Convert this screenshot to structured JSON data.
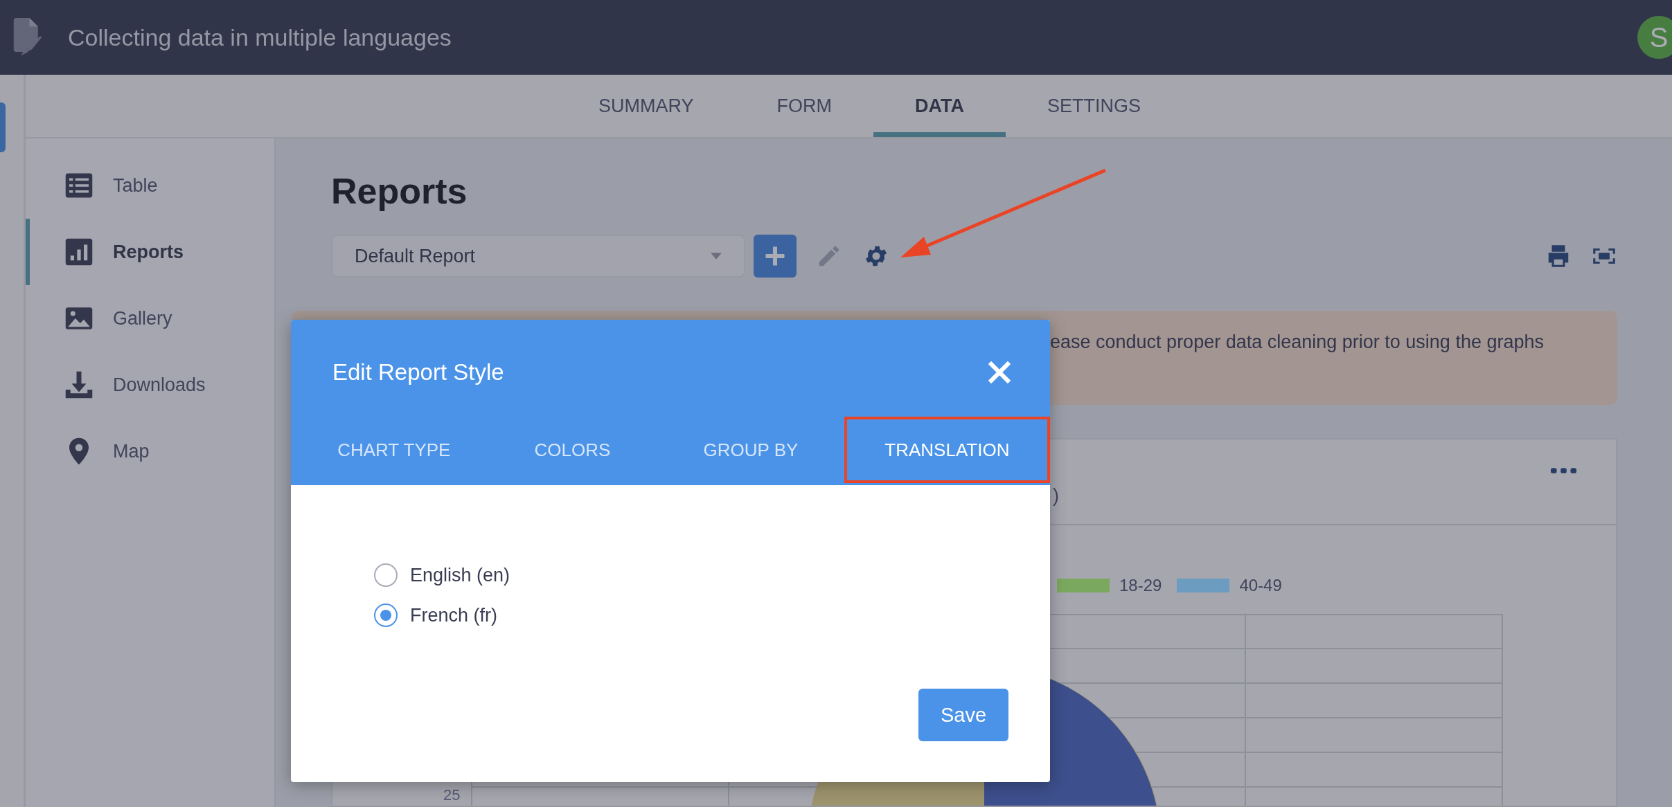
{
  "app_bar": {
    "title": "Collecting data in multiple languages",
    "avatar": "S"
  },
  "nav_tabs": [
    {
      "label": "SUMMARY",
      "selected": false
    },
    {
      "label": "FORM",
      "selected": false
    },
    {
      "label": "DATA",
      "selected": true
    },
    {
      "label": "SETTINGS",
      "selected": false
    }
  ],
  "sidebar": {
    "items": [
      {
        "label": "Table",
        "selected": false
      },
      {
        "label": "Reports",
        "selected": true
      },
      {
        "label": "Gallery",
        "selected": false
      },
      {
        "label": "Downloads",
        "selected": false
      },
      {
        "label": "Map",
        "selected": false
      }
    ]
  },
  "page": {
    "heading": "Reports",
    "report_select": {
      "value": "Default Report"
    }
  },
  "notice": {
    "text": "ease conduct proper data cleaning prior to using the graphs"
  },
  "chart_card": {
    "subtitle": ")",
    "legend": [
      {
        "label": "18-29",
        "color": "#7ba85f"
      },
      {
        "label": "40-49",
        "color": "#6c9cc0"
      }
    ],
    "y_tick": "25"
  },
  "dialog": {
    "title": "Edit Report Style",
    "tabs": [
      {
        "label": "CHART TYPE",
        "selected": false,
        "highlighted": false
      },
      {
        "label": "COLORS",
        "selected": false,
        "highlighted": false
      },
      {
        "label": "GROUP BY",
        "selected": false,
        "highlighted": false
      },
      {
        "label": "TRANSLATION",
        "selected": true,
        "highlighted": true
      }
    ],
    "options": [
      {
        "label": "English (en)",
        "selected": false
      },
      {
        "label": "French (fr)",
        "selected": true
      }
    ],
    "save_label": "Save"
  }
}
